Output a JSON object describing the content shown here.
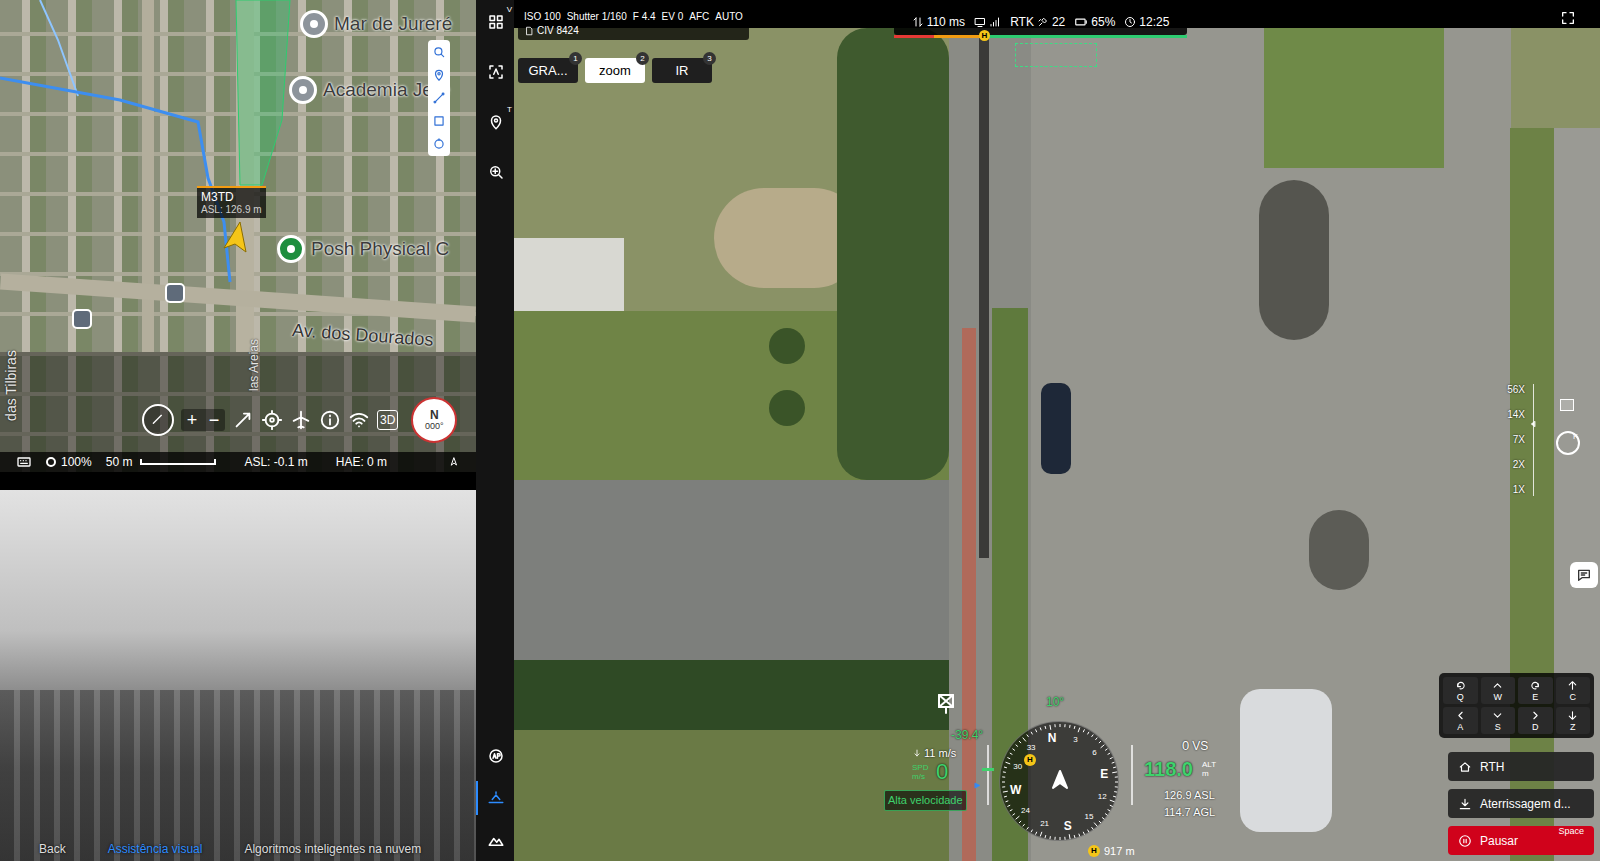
{
  "map": {
    "places": [
      {
        "label": "Mar de Jureré",
        "kind": "place"
      },
      {
        "label": "Academia Jere",
        "kind": "place"
      },
      {
        "label": "Posh Physical C",
        "kind": "business"
      }
    ],
    "streets": [
      "Av. dos Dourados",
      "das Tilbiras",
      "las Areias"
    ],
    "aircraft": {
      "name": "M3TD",
      "altitude": "ASL: 126.9 m"
    },
    "tools": [
      {
        "kind": "search"
      },
      {
        "kind": "pin"
      },
      {
        "kind": "line"
      },
      {
        "kind": "area"
      },
      {
        "kind": "circle"
      }
    ],
    "controls": {
      "zoom_in": "+",
      "zoom_out": "−",
      "mode": "3D",
      "north": "N",
      "heading": "000°"
    },
    "status": {
      "zoom": "100%",
      "scale": "50 m",
      "asl": "ASL: -0.1 m",
      "hae": "HAE: 0 m"
    }
  },
  "aux_view": {
    "tabs": [
      {
        "label": "Back",
        "selected": false
      },
      {
        "label": "Assistência visual",
        "selected": true
      },
      {
        "label": "Algoritmos inteligentes na nuvem",
        "selected": false
      }
    ]
  },
  "side_toolbar": [
    {
      "kind": "layout",
      "hotkey": "V",
      "selected": false
    },
    {
      "kind": "ai-target",
      "selected": false
    },
    {
      "kind": "pin",
      "hotkey": "T",
      "selected": false
    },
    {
      "kind": "search-zoom",
      "selected": false
    },
    {
      "kind": "ar",
      "selected": false
    },
    {
      "kind": "horizon",
      "selected": true
    },
    {
      "kind": "mountain",
      "selected": false
    }
  ],
  "camera": {
    "params": [
      "ISO 100",
      "Shutter 1/160",
      "F 4.4",
      "EV 0",
      "AFC",
      "AUTO"
    ],
    "storage": "CIV 8424",
    "lenses": [
      {
        "label": "GRA...",
        "badge": "1",
        "selected": false
      },
      {
        "label": "zoom",
        "badge": "2",
        "selected": true
      },
      {
        "label": "IR",
        "badge": "3",
        "selected": false
      }
    ]
  },
  "link": {
    "latency": "110 ms",
    "rtk": "RTK",
    "satellites": "22",
    "battery": "65%",
    "time": "12:25",
    "home_marker": "H"
  },
  "zoom_scale": {
    "labels": [
      "56X",
      "14X",
      "7X",
      "2X",
      "1X"
    ],
    "focus": "F"
  },
  "hud": {
    "gimbal_pitch": "-39.4°",
    "heading": "10°",
    "descent": "11 m/s",
    "speed_label": "SPD",
    "speed_unit": "m/s",
    "speed": "0",
    "warning": "Alta velocidade",
    "vs": "0",
    "vs_label": "VS",
    "altitude": "118.0",
    "alt_label": "ALT",
    "alt_unit": "m",
    "asl": "126.9 ASL",
    "agl": "114.7 AGL",
    "home_distance": "917 m",
    "home_marker": "H",
    "compass": [
      "N",
      "3",
      "6",
      "E",
      "12",
      "15",
      "S",
      "21",
      "24",
      "W",
      "30",
      "33"
    ]
  },
  "keys": [
    {
      "key": "Q",
      "kind": "rotate-left"
    },
    {
      "key": "W",
      "kind": "up"
    },
    {
      "key": "E",
      "kind": "rotate-right"
    },
    {
      "key": "C",
      "kind": "ascend"
    },
    {
      "key": "A",
      "kind": "left"
    },
    {
      "key": "S",
      "kind": "down"
    },
    {
      "key": "D",
      "kind": "right"
    },
    {
      "key": "Z",
      "kind": "descend"
    }
  ],
  "actions": [
    {
      "label": "RTH",
      "kind": "rth"
    },
    {
      "label": "Aterrissagem d...",
      "kind": "land"
    },
    {
      "label": "Pausar",
      "kind": "pause",
      "shortcut": "Space"
    }
  ]
}
